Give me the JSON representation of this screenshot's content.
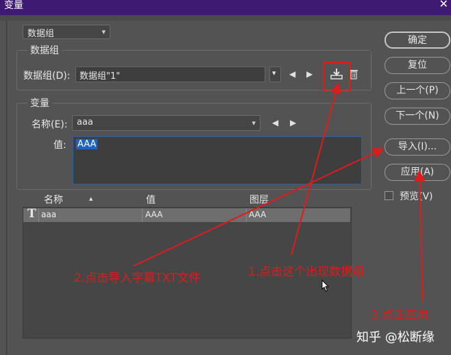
{
  "window": {
    "title": "变量",
    "close_glyph": "✕"
  },
  "top_dropdown": {
    "value": "数据组"
  },
  "dataset_group": {
    "legend": "数据组",
    "label": "数据组(D):",
    "value": "数据组\"1\""
  },
  "variables_group": {
    "legend": "变量",
    "name_label": "名称(E):",
    "name_value": "aaa",
    "value_label": "值:",
    "value_text": "AAA"
  },
  "table": {
    "columns": [
      "名称",
      "值",
      "图层"
    ],
    "sort_indicator": "▲",
    "rows": [
      {
        "type_icon": "T",
        "name": "aaa",
        "value": "AAA",
        "layer": "AAA"
      }
    ]
  },
  "buttons": {
    "ok": "确定",
    "reset": "复位",
    "prev": "上一个(P)",
    "next": "下一个(N)",
    "import": "导入(I)...",
    "apply": "应用(A)",
    "preview": "预览(V)"
  },
  "nav_glyphs": {
    "left": "◀",
    "right": "▶",
    "dropdown": "⌄"
  },
  "annotations": {
    "step1": "1.点击这个出现数据组",
    "step2": "2.点击导入字幕TXT文件",
    "step3": "3.点击应用"
  },
  "watermark": "知乎 @松断缘",
  "colors": {
    "annotation": "#e01b1b",
    "titlebar": "#3f1a73",
    "selection": "#1e63c4"
  }
}
